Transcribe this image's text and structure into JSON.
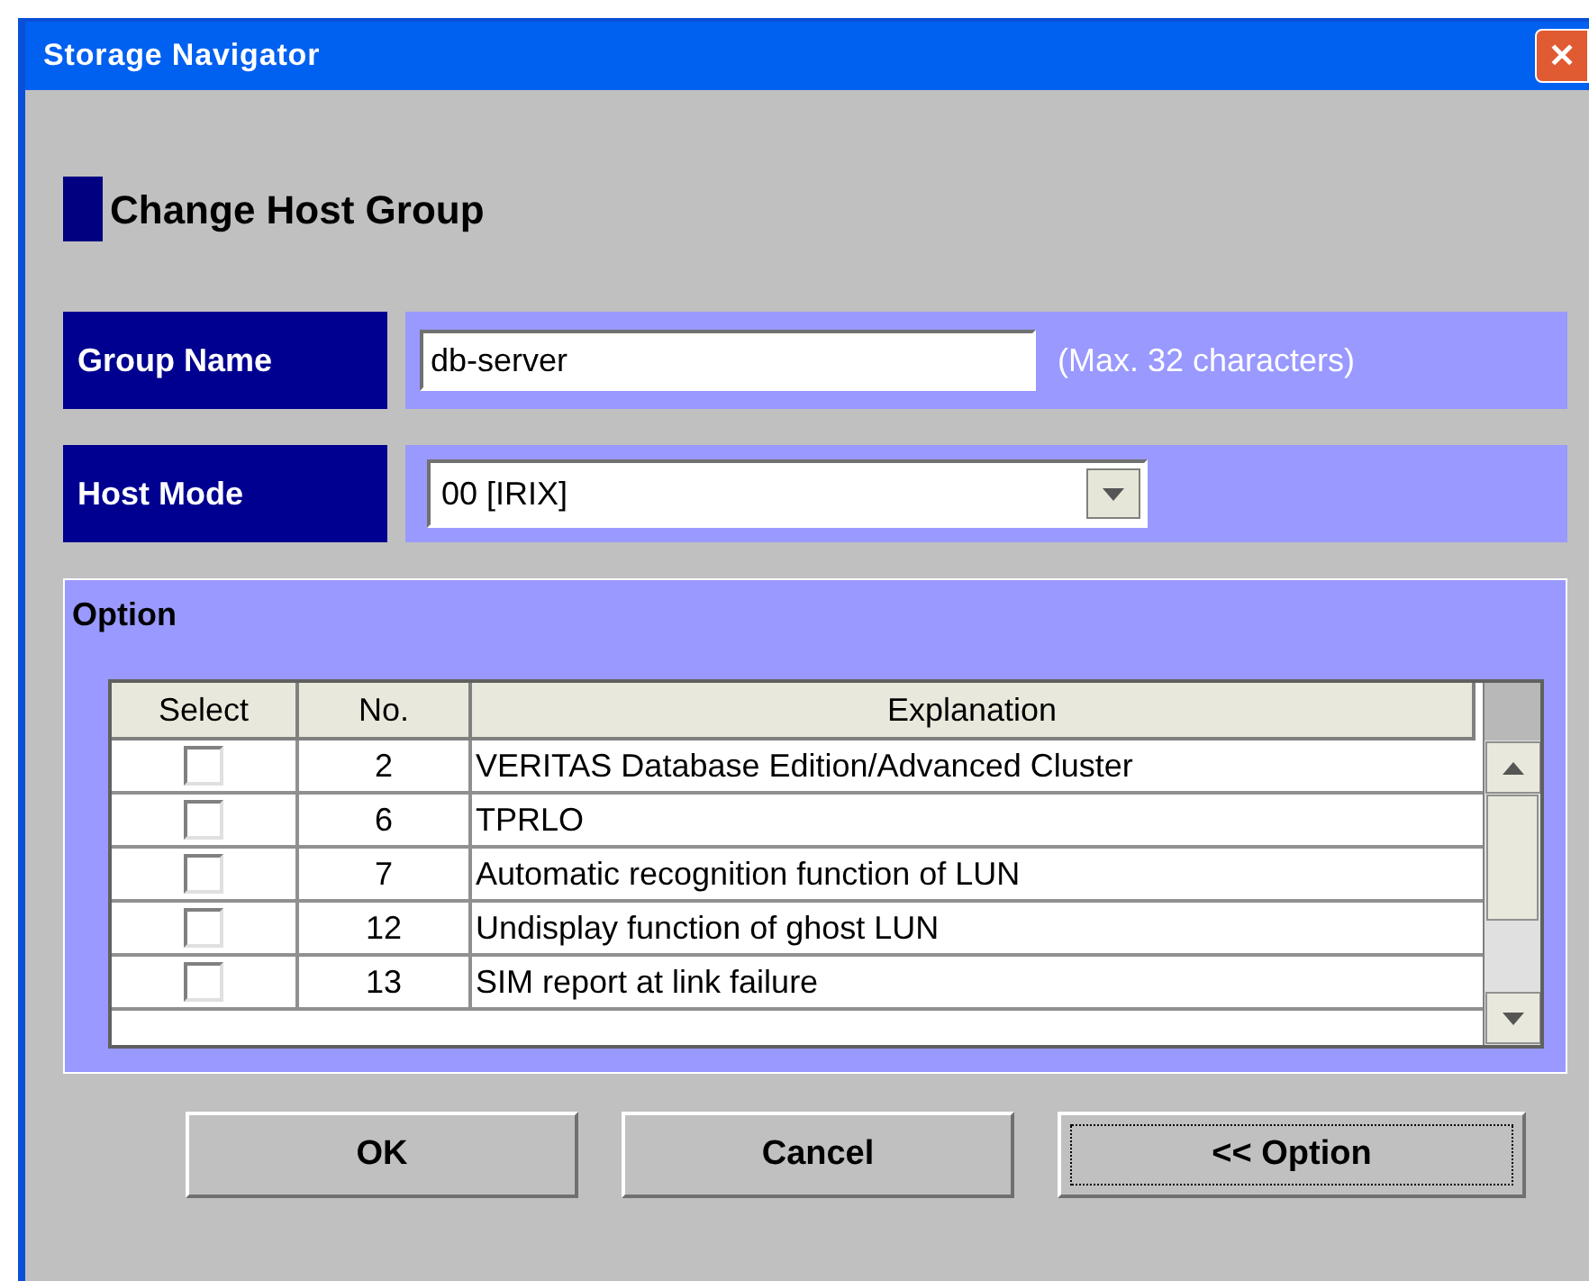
{
  "window": {
    "title": "Storage Navigator",
    "close": "✕"
  },
  "heading": "Change Host Group",
  "group_name": {
    "label": "Group Name",
    "value": "db-server",
    "hint": "(Max. 32 characters)"
  },
  "host_mode": {
    "label": "Host Mode",
    "value": "00 [IRIX]"
  },
  "option": {
    "title": "Option",
    "table": {
      "columns": [
        "Select",
        "No.",
        "Explanation"
      ],
      "rows": [
        {
          "checked": false,
          "no": "2",
          "explanation": "VERITAS Database Edition/Advanced Cluster"
        },
        {
          "checked": false,
          "no": "6",
          "explanation": "TPRLO"
        },
        {
          "checked": false,
          "no": "7",
          "explanation": "Automatic recognition function of LUN"
        },
        {
          "checked": false,
          "no": "12",
          "explanation": "Undisplay function of ghost LUN"
        },
        {
          "checked": false,
          "no": "13",
          "explanation": "SIM report at link failure"
        }
      ]
    }
  },
  "buttons": [
    {
      "label": "OK",
      "focused": false
    },
    {
      "label": "Cancel",
      "focused": false
    },
    {
      "label": "<< Option",
      "focused": true
    }
  ]
}
